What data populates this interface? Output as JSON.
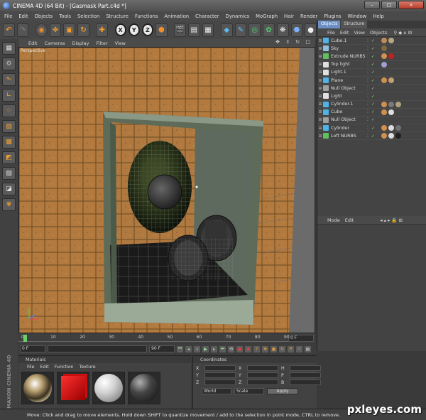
{
  "window": {
    "title": "CINEMA 4D (64 Bit) - [Gasmask Part.c4d *]",
    "buttons": [
      "–",
      "□",
      "×"
    ]
  },
  "menu": [
    "File",
    "Edit",
    "Objects",
    "Tools",
    "Selection",
    "Structure",
    "Functions",
    "Animation",
    "Character",
    "Dynamics",
    "MoGraph",
    "Hair",
    "Render",
    "Plugins",
    "Window",
    "Help"
  ],
  "toolbar": {
    "axis_x": "X",
    "axis_y": "Y",
    "axis_z": "Z"
  },
  "viewport": {
    "menu": [
      "Edit",
      "Cameras",
      "Display",
      "Filter",
      "View"
    ],
    "label": "Perspective",
    "nav_icons": "✥ ⇳ ↻ □"
  },
  "objects_panel": {
    "tabs": [
      "Objects",
      "Structure"
    ],
    "menu": [
      "File",
      "Edit",
      "View",
      "Objects"
    ],
    "items": [
      {
        "name": "Cube.1",
        "icon_color": "#4fb3e8",
        "tags": [
          "#c08a5a",
          "#b8a880"
        ]
      },
      {
        "name": "Sky",
        "icon_color": "#8fbfdf",
        "tags": [
          "#7a6a40"
        ]
      },
      {
        "name": "Extrude NURBS",
        "icon_color": "#60c060",
        "tags": [
          "#d09050",
          "#c02020"
        ]
      },
      {
        "name": "Top light",
        "icon_color": "#e0e0e0",
        "tags": [
          "#a0a0d0"
        ]
      },
      {
        "name": "Light.1",
        "icon_color": "#e0e0e0",
        "tags": []
      },
      {
        "name": "Plane",
        "icon_color": "#4fb3e8",
        "tags": [
          "#d09050",
          "#c0a070"
        ]
      },
      {
        "name": "Null Object",
        "icon_color": "#a0a0a0",
        "tags": []
      },
      {
        "name": "Light",
        "icon_color": "#e0e0e0",
        "tags": []
      },
      {
        "name": "Cylinder.1",
        "icon_color": "#4fb3e8",
        "tags": [
          "#d09050",
          "#7a7a7a",
          "#b0a080"
        ]
      },
      {
        "name": "Cube",
        "icon_color": "#4fb3e8",
        "tags": [
          "#d09050",
          "#dddddd"
        ]
      },
      {
        "name": "Null Object",
        "icon_color": "#a0a0a0",
        "tags": []
      },
      {
        "name": "Cylinder",
        "icon_color": "#4fb3e8",
        "tags": [
          "#d09050",
          "#dddddd",
          "#707070"
        ]
      },
      {
        "name": "Loft NURBS",
        "icon_color": "#60c060",
        "tags": [
          "#d09050",
          "#dddddd",
          "#202020"
        ]
      }
    ]
  },
  "attributes_panel": {
    "menu": [
      "Mode",
      "Edit"
    ]
  },
  "timeline": {
    "ticks": [
      "0",
      "10",
      "20",
      "30",
      "40",
      "50",
      "60",
      "70",
      "80",
      "90"
    ],
    "current_frame": "0 F",
    "progress": 0.02
  },
  "transport": {
    "start": "0 F",
    "end": "90 F"
  },
  "materials": {
    "title": "Materials",
    "menu": [
      "File",
      "Edit",
      "Function",
      "Texture"
    ],
    "swatches": [
      "chrome",
      "red",
      "white",
      "dark"
    ]
  },
  "coordinates": {
    "title": "Coordinates",
    "rows": [
      [
        "X",
        "X",
        "H"
      ],
      [
        "Y",
        "Y",
        "P"
      ],
      [
        "Z",
        "Z",
        "B"
      ]
    ],
    "mode_world": "World",
    "mode_scale": "Scale",
    "apply": "Apply"
  },
  "branding": {
    "vertical": "MAXON CINEMA 4D"
  },
  "status": {
    "text": "Move: Click and drag to move elements. Hold down SHIFT to quantize movement / add to the selection in point mode, CTRL to remove."
  },
  "watermark": "pxleyes.com"
}
